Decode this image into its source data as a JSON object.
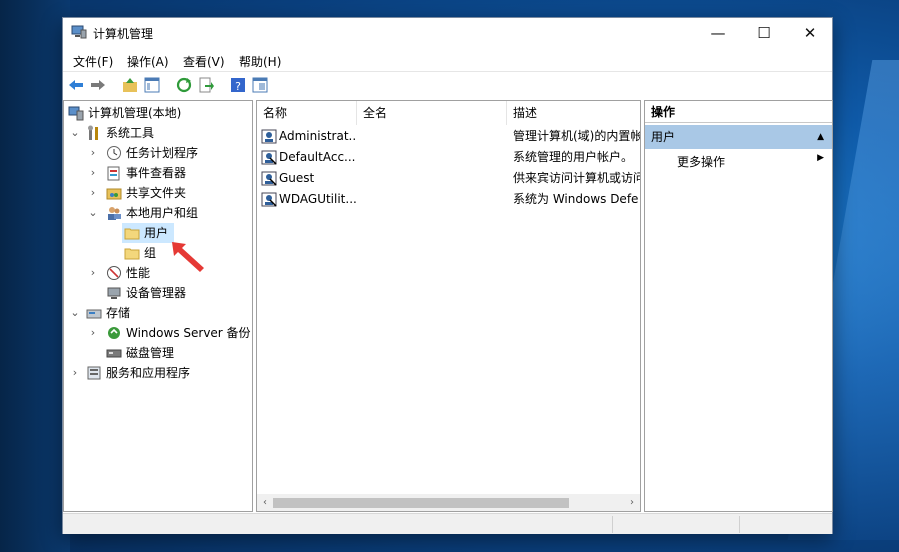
{
  "window": {
    "title": "计算机管理",
    "controls": {
      "minimize": "—",
      "maximize": "☐",
      "close": "✕"
    }
  },
  "menu": [
    {
      "label": "文件(F)"
    },
    {
      "label": "操作(A)"
    },
    {
      "label": "查看(V)"
    },
    {
      "label": "帮助(H)"
    }
  ],
  "toolbar": [
    "back-icon",
    "forward-icon",
    "up-folder-icon",
    "show-tree-icon",
    "refresh-icon",
    "export-icon",
    "help-icon",
    "properties-icon"
  ],
  "tree": {
    "root": "计算机管理(本地)",
    "system_tools": "系统工具",
    "task_scheduler": "任务计划程序",
    "event_viewer": "事件查看器",
    "shared_folders": "共享文件夹",
    "local_users_groups": "本地用户和组",
    "users": "用户",
    "groups": "组",
    "performance": "性能",
    "device_manager": "设备管理器",
    "storage": "存储",
    "windows_server_backup": "Windows Server 备份",
    "disk_management": "磁盘管理",
    "services_apps": "服务和应用程序"
  },
  "list": {
    "columns": [
      "名称",
      "全名",
      "描述"
    ],
    "rows": [
      {
        "name": "Administrat...",
        "fullname": "",
        "description": "管理计算机(域)的内置帐"
      },
      {
        "name": "DefaultAcc...",
        "fullname": "",
        "description": "系统管理的用户帐户。"
      },
      {
        "name": "Guest",
        "fullname": "",
        "description": "供来宾访问计算机或访问"
      },
      {
        "name": "WDAGUtilit...",
        "fullname": "",
        "description": "系统为 Windows Defe"
      }
    ]
  },
  "actions": {
    "header": "操作",
    "section": "用户",
    "more": "更多操作"
  },
  "colors": {
    "selection": "#cce8ff",
    "action_section": "#a9c8e6",
    "annotation_arrow": "#e53935"
  }
}
